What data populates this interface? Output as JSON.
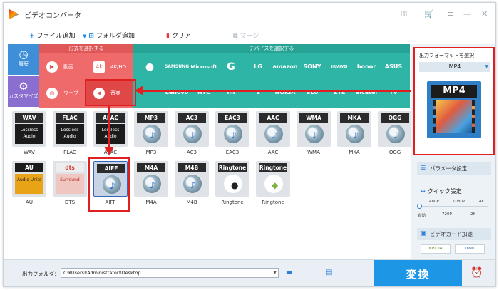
{
  "window": {
    "title": "ビデオコンバータ"
  },
  "toolbar": {
    "add_file": "ファイル追加",
    "add_folder": "フォルダ追加",
    "clear": "クリア",
    "merge": "マージ"
  },
  "format_panel": {
    "header": "形式を選択する",
    "rail": [
      {
        "label": "履歴",
        "icon": "history-icon"
      },
      {
        "label": "カスタマイズ",
        "icon": "customize-icon"
      }
    ],
    "buttons": [
      {
        "label": "動画",
        "icon": "play-icon"
      },
      {
        "label": "4K/HD",
        "icon": "4k-icon"
      },
      {
        "label": "ウェブ",
        "icon": "chrome-icon"
      },
      {
        "label": "音楽",
        "icon": "speaker-icon"
      }
    ]
  },
  "device_panel": {
    "header": "デバイスを選択する",
    "row1": [
      "",
      "SAMSUNG",
      "Microsoft",
      "G",
      "LG",
      "amazon",
      "SONY",
      "HUAWEI",
      "honor",
      "ASUS"
    ],
    "row2": [
      "Lenovo",
      "HTC",
      "mi",
      "1",
      "NOKIA",
      "BLU",
      "ZTE",
      "alcatel",
      "TV"
    ]
  },
  "formats": [
    {
      "name": "WAV",
      "label": "WAV",
      "sub": "Lossless Audio"
    },
    {
      "name": "FLAC",
      "label": "FLAC",
      "sub": "Lossless Audio"
    },
    {
      "name": "ALAC",
      "label": "ALAC",
      "sub": "Lossless Audio"
    },
    {
      "name": "MP3",
      "label": "MP3",
      "sub": ""
    },
    {
      "name": "AC3",
      "label": "AC3",
      "sub": ""
    },
    {
      "name": "EAC3",
      "label": "EAC3",
      "sub": ""
    },
    {
      "name": "AAC",
      "label": "AAC",
      "sub": ""
    },
    {
      "name": "WMA",
      "label": "WMA",
      "sub": ""
    },
    {
      "name": "MKA",
      "label": "MKA",
      "sub": ""
    },
    {
      "name": "OGG",
      "label": "OGG",
      "sub": ""
    },
    {
      "name": "AU",
      "label": "AU",
      "sub": "Audio Units"
    },
    {
      "name": "dts",
      "label": "DTS",
      "sub": "Surround"
    },
    {
      "name": "AIFF",
      "label": "AIFF",
      "sub": ""
    },
    {
      "name": "M4A",
      "label": "M4A",
      "sub": ""
    },
    {
      "name": "M4B",
      "label": "M4B",
      "sub": ""
    },
    {
      "name": "Ringtone",
      "label": "Ringtone",
      "sub": ""
    },
    {
      "name": "Ringtone",
      "label": "Ringtone",
      "sub": ""
    }
  ],
  "right_panel": {
    "title": "出力フォーマットを選択",
    "selected_format": "MP4",
    "preview_badge": "MP4",
    "params_button": "パラメータ設定",
    "quick_title": "クイック設定",
    "quality_top": [
      "480P",
      "1080P",
      "4K"
    ],
    "quality_bottom": [
      "自動",
      "720P",
      "2K"
    ],
    "quality_level": 0.0,
    "gpu_title": "ビデオカード加速",
    "gpu_nvidia": "NVIDIA",
    "gpu_intel": "Intel"
  },
  "bottom": {
    "output_label": "出力フォルダ：",
    "output_path": "C:¥Users¥Administrator¥Desktop",
    "convert": "変換"
  },
  "colors": {
    "accent": "#1e96e6",
    "format_red": "#ef6b6b",
    "device_teal": "#2fb5a6",
    "highlight": "#e02020"
  }
}
